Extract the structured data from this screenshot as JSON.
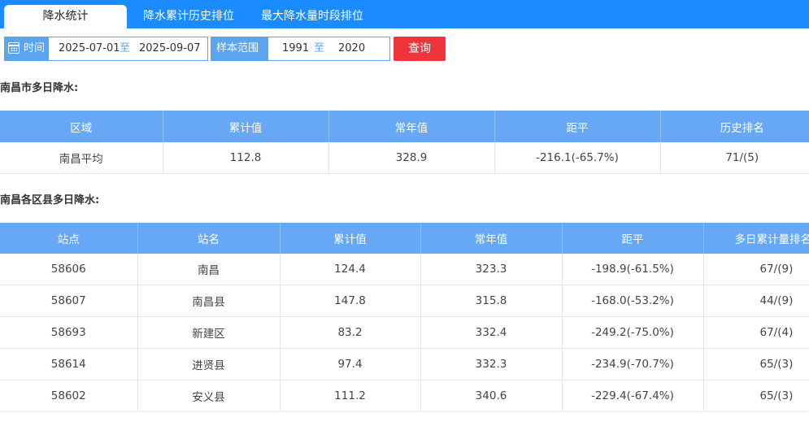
{
  "tabs": [
    {
      "label": "降水统计",
      "active": true
    },
    {
      "label": "降水累计历史排位",
      "active": false
    },
    {
      "label": "最大降水量时段排位",
      "active": false
    }
  ],
  "filter": {
    "time_label": "时间",
    "date_start": "2025-07-01",
    "date_sep": "至",
    "date_end": "2025-09-07",
    "sample_label": "样本范围",
    "year_start": "1991",
    "year_sep": "至",
    "year_end": "2020",
    "query_label": "查询"
  },
  "section1": {
    "title": "南昌市多日降水:",
    "headers": [
      "区域",
      "累计值",
      "常年值",
      "距平",
      "历史排名"
    ],
    "rows": [
      [
        "南昌平均",
        "112.8",
        "328.9",
        "-216.1(-65.7%)",
        "71/(5)"
      ]
    ]
  },
  "section2": {
    "title": "南昌各区县多日降水:",
    "headers": [
      "站点",
      "站名",
      "累计值",
      "常年值",
      "距平",
      "多日累计量排名"
    ],
    "rows": [
      [
        "58606",
        "南昌",
        "124.4",
        "323.3",
        "-198.9(-61.5%)",
        "67/(9)"
      ],
      [
        "58607",
        "南昌县",
        "147.8",
        "315.8",
        "-168.0(-53.2%)",
        "44/(9)"
      ],
      [
        "58693",
        "新建区",
        "83.2",
        "332.4",
        "-249.2(-75.0%)",
        "67/(4)"
      ],
      [
        "58614",
        "进贤县",
        "97.4",
        "332.3",
        "-234.9(-70.7%)",
        "65/(3)"
      ],
      [
        "58602",
        "安义县",
        "111.2",
        "340.6",
        "-229.4(-67.4%)",
        "65/(3)"
      ]
    ]
  },
  "colors": {
    "tabbar": "#1a8cff",
    "header": "#66a8f5",
    "query_button": "#f0343c"
  },
  "icons": {
    "time": "calendar-icon"
  }
}
